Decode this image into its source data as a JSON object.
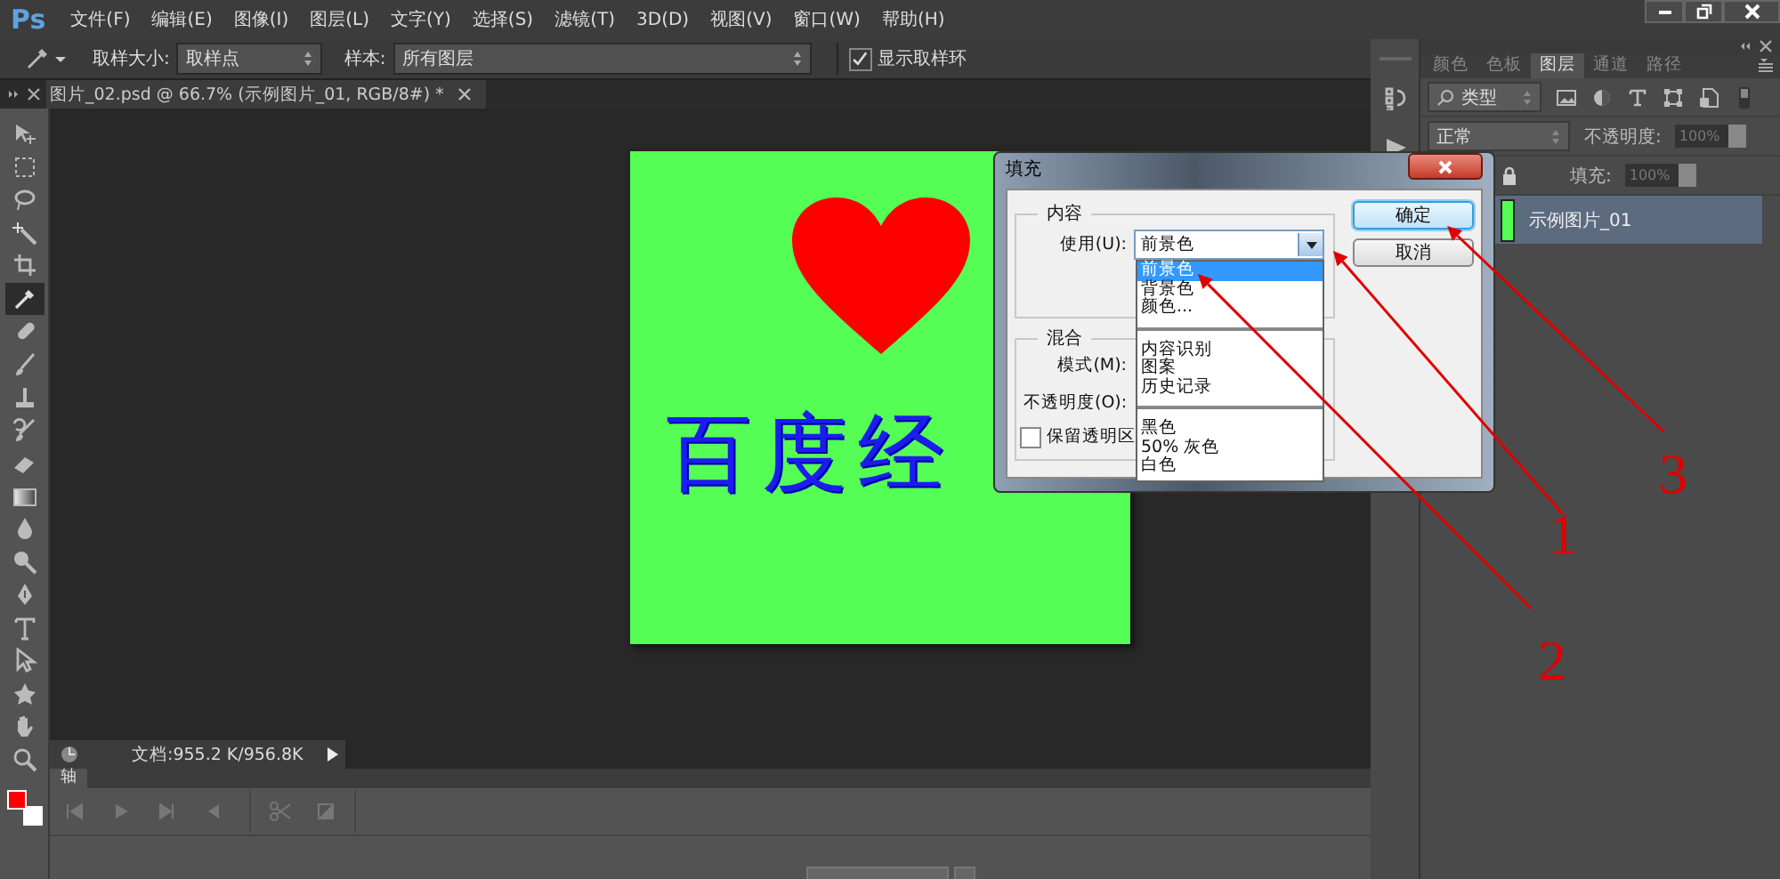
{
  "menubar": {
    "logo": "Ps",
    "items": [
      "文件(F)",
      "编辑(E)",
      "图像(I)",
      "图层(L)",
      "文字(Y)",
      "选择(S)",
      "滤镜(T)",
      "3D(D)",
      "视图(V)",
      "窗口(W)",
      "帮助(H)"
    ]
  },
  "options_bar": {
    "sample_size_label": "取样大小:",
    "sample_size": "取样点",
    "sample_label": "样本:",
    "sample": "所有图层",
    "show_ring": {
      "label": "显示取样环",
      "checked": true
    }
  },
  "document_tab": {
    "title": "图片_02.psd @ 66.7% (示例图片_01, RGB/8#) *"
  },
  "tools": [
    {
      "kind": "move",
      "selected": false
    },
    {
      "kind": "marquee",
      "selected": false
    },
    {
      "kind": "lasso",
      "selected": false
    },
    {
      "kind": "wand",
      "selected": false
    },
    {
      "kind": "crop",
      "selected": false
    },
    {
      "kind": "eyedropper",
      "selected": true
    },
    {
      "kind": "healing",
      "selected": false
    },
    {
      "kind": "brush",
      "selected": false
    },
    {
      "kind": "stamp",
      "selected": false
    },
    {
      "kind": "history",
      "selected": false
    },
    {
      "kind": "eraser",
      "selected": false
    },
    {
      "kind": "gradient",
      "selected": false
    },
    {
      "kind": "drop",
      "selected": false
    },
    {
      "kind": "dodge",
      "selected": false
    },
    {
      "kind": "pen",
      "selected": false
    },
    {
      "kind": "type",
      "selected": false
    },
    {
      "kind": "select",
      "selected": false
    },
    {
      "kind": "shape",
      "selected": false
    },
    {
      "kind": "hand",
      "selected": false
    },
    {
      "kind": "zoom",
      "selected": false
    }
  ],
  "swatches": [
    {
      "kind": "foreground",
      "color": "#ff0000"
    },
    {
      "kind": "background",
      "color": "#ffffff"
    }
  ],
  "canvas": {
    "text": "百度经"
  },
  "status_bar": {
    "doc_info": "文档:955.2 K/956.8K"
  },
  "timeline": {
    "tab": "轴"
  },
  "layers_panel": {
    "tabs": [
      {
        "label": "颜色",
        "selected": false
      },
      {
        "label": "色板",
        "selected": false
      },
      {
        "label": "图层",
        "selected": true
      },
      {
        "label": "通道",
        "selected": false
      },
      {
        "label": "路径",
        "selected": false
      }
    ],
    "filter": "类型",
    "blend_mode": "正常",
    "opacity_label": "不透明度:",
    "opacity": "100%",
    "fill_label": "填充:",
    "fill": "100%",
    "layers": [
      {
        "name": "示例图片_01",
        "selected": true
      }
    ]
  },
  "dialog": {
    "title": "填充",
    "content_group": "内容",
    "use_label": "使用(U):",
    "use_value": "前景色",
    "blend_group": "混合",
    "mode_label": "模式(M):",
    "opacity_label": "不透明度(O):",
    "preserve": {
      "label": "保留透明区",
      "checked": false
    },
    "dropdown": {
      "groups": [
        {
          "items": [
            {
              "label": "前景色",
              "selected": true
            },
            {
              "label": "背景色",
              "selected": false
            },
            {
              "label": "颜色...",
              "selected": false
            }
          ]
        },
        {
          "items": [
            {
              "label": "内容识别",
              "selected": false
            },
            {
              "label": "图案",
              "selected": false
            },
            {
              "label": "历史记录",
              "selected": false
            }
          ]
        },
        {
          "items": [
            {
              "label": "黑色",
              "selected": false
            },
            {
              "label": "50% 灰色",
              "selected": false
            },
            {
              "label": "白色",
              "selected": false
            }
          ]
        }
      ]
    },
    "buttons": [
      {
        "label": "确定",
        "default": true
      },
      {
        "label": "取消",
        "default": false
      }
    ]
  },
  "annotations": [
    {
      "label": "1"
    },
    {
      "label": "2"
    },
    {
      "label": "3"
    }
  ]
}
